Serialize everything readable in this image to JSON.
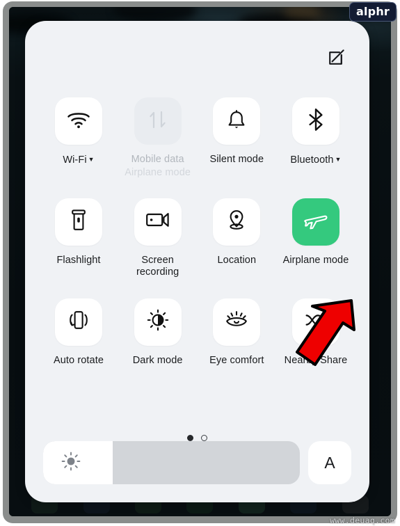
{
  "watermarks": {
    "brand": "alphr",
    "site": "www.deuaq.com"
  },
  "panel": {
    "edit_icon": "edit-square-icon"
  },
  "tiles": [
    [
      {
        "label": "Wi-Fi",
        "icon": "wifi-icon",
        "state": "on",
        "has_caret": true,
        "sublabel": ""
      },
      {
        "label": "Mobile data",
        "icon": "data-transfer-icon",
        "state": "disabled",
        "has_caret": false,
        "sublabel": "Airplane mode"
      },
      {
        "label": "Silent mode",
        "icon": "bell-icon",
        "state": "on",
        "has_caret": false,
        "sublabel": ""
      },
      {
        "label": "Bluetooth",
        "icon": "bluetooth-icon",
        "state": "on",
        "has_caret": true,
        "sublabel": ""
      }
    ],
    [
      {
        "label": "Flashlight",
        "icon": "flashlight-icon",
        "state": "on",
        "has_caret": false,
        "sublabel": ""
      },
      {
        "label": "Screen recording",
        "icon": "screen-record-icon",
        "state": "on",
        "has_caret": false,
        "sublabel": ""
      },
      {
        "label": "Location",
        "icon": "location-pin-icon",
        "state": "on",
        "has_caret": false,
        "sublabel": ""
      },
      {
        "label": "Airplane mode",
        "icon": "airplane-icon",
        "state": "active",
        "has_caret": false,
        "sublabel": ""
      }
    ],
    [
      {
        "label": "Auto rotate",
        "icon": "auto-rotate-icon",
        "state": "on",
        "has_caret": false,
        "sublabel": ""
      },
      {
        "label": "Dark mode",
        "icon": "brightness-contrast-icon",
        "state": "on",
        "has_caret": false,
        "sublabel": ""
      },
      {
        "label": "Eye comfort",
        "icon": "eye-comfort-icon",
        "state": "on",
        "has_caret": false,
        "sublabel": ""
      },
      {
        "label": "Nearby Share",
        "icon": "nearby-share-icon",
        "state": "on",
        "has_caret": false,
        "sublabel": ""
      }
    ]
  ],
  "pager": {
    "pages": 2,
    "current_page": 1
  },
  "bottom_bar": {
    "brightness_icon": "sun-icon",
    "brightness_percent": 27,
    "auto_brightness_label": "A"
  },
  "annotation": {
    "arrow": "red-arrow-pointing-to-airplane-mode",
    "arrow_color": "#ee0000"
  },
  "colors": {
    "panel_bg": "#f0f2f5",
    "tile_bg": "#ffffff",
    "tile_active_bg": "#34c97e",
    "tile_disabled_bg": "#e9ecf0",
    "label": "#1a1c1e",
    "label_dim": "#b2b7bd",
    "slider_track": "#d2d5d9",
    "frame": "#8a8d8c"
  }
}
